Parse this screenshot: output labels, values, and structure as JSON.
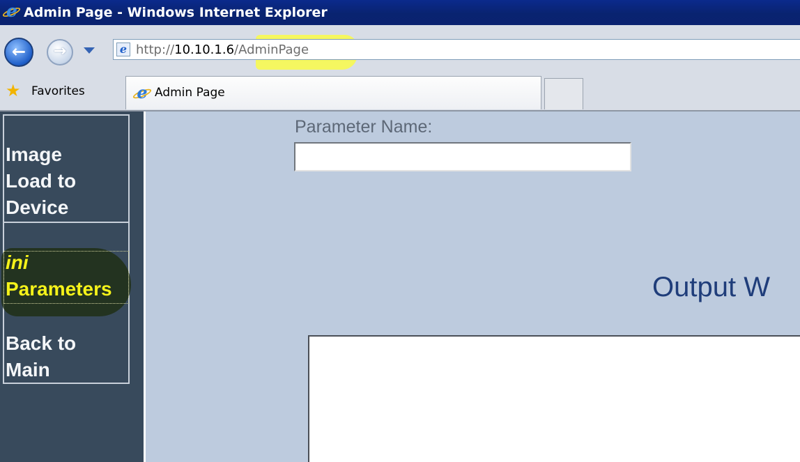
{
  "window": {
    "title": "Admin Page - Windows Internet Explorer"
  },
  "navbar": {
    "url_protocol": "http://",
    "url_host": "10.10.1.6",
    "url_path": "/AdminPage"
  },
  "favorites": {
    "label": "Favorites"
  },
  "tabs": [
    {
      "label": "Admin Page",
      "active": true
    }
  ],
  "sidebar": {
    "items": [
      {
        "lines": [
          "Image",
          "Load to",
          "Device"
        ]
      },
      {
        "lines": [
          "ini",
          "Parameters"
        ]
      },
      {
        "lines": [
          "Back to",
          "Main"
        ]
      }
    ]
  },
  "main": {
    "param_label": "Parameter Name:",
    "param_value": "",
    "output_title": "Output W"
  },
  "colors": {
    "title_bar": "#092370",
    "page_background": "#bdcbde",
    "sidebar_background": "#384a5c",
    "highlight_yellow": "#ffff33",
    "output_title": "#1f3d7a"
  }
}
